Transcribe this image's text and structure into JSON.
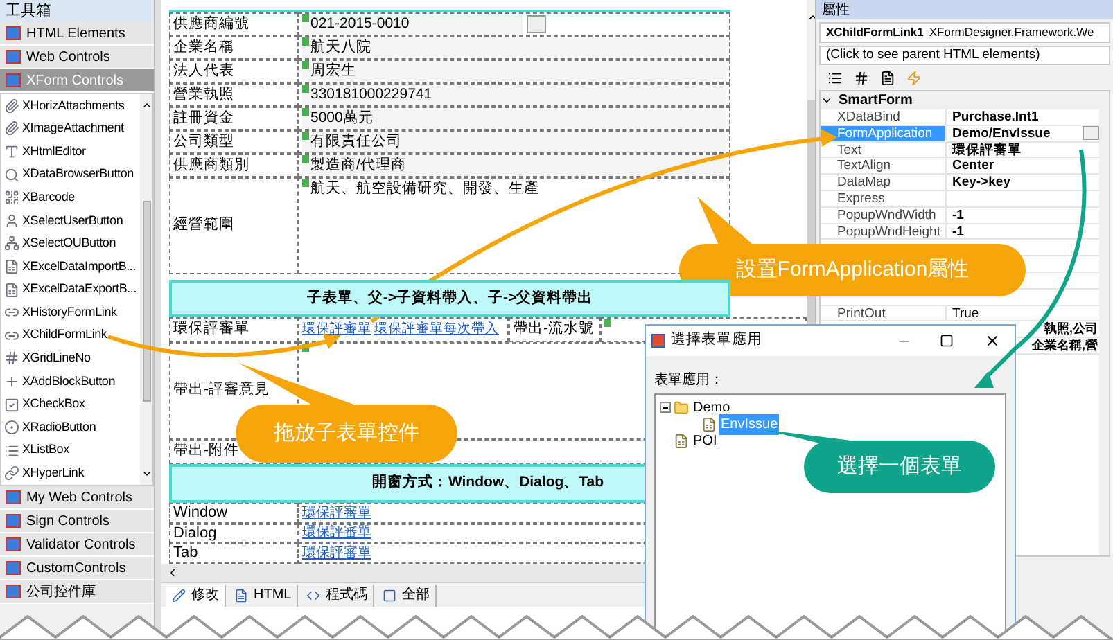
{
  "toolbox": {
    "title": "工具箱",
    "categories_top": [
      {
        "label": "HTML Elements",
        "selected": false
      },
      {
        "label": "Web Controls",
        "selected": false
      },
      {
        "label": "XForm Controls",
        "selected": true
      }
    ],
    "items": [
      "XHorizAttachments",
      "XImageAttachment",
      "XHtmlEditor",
      "XDataBrowserButton",
      "XBarcode",
      "XSelectUserButton",
      "XSelectOUButton",
      "XExcelDataImportB...",
      "XExcelDataExportB...",
      "XHistoryFormLink",
      "XChildFormLink",
      "XGridLineNo",
      "XAddBlockButton",
      "XCheckBox",
      "XRadioButton",
      "XListBox",
      "XHyperLink"
    ],
    "categories_bottom": [
      {
        "label": "My Web Controls",
        "selected": false
      },
      {
        "label": "Sign Controls",
        "selected": false
      },
      {
        "label": "Validator Controls",
        "selected": false
      },
      {
        "label": "CustomControls",
        "selected": false
      },
      {
        "label": "公司控件庫",
        "selected": false
      }
    ]
  },
  "designer": {
    "info_rows": [
      {
        "label": "供應商編號",
        "value": "021-2015-0010",
        "kind": "button"
      },
      {
        "label": "企業名稱",
        "value": "航天八院",
        "kind": "text"
      },
      {
        "label": "法人代表",
        "value": "周宏生",
        "kind": "text"
      },
      {
        "label": "營業執照",
        "value": "330181000229741",
        "kind": "text"
      },
      {
        "label": "註冊資金",
        "value": "5000萬元",
        "kind": "text"
      },
      {
        "label": "公司類型",
        "value": "有限責任公司",
        "kind": "text"
      },
      {
        "label": "供應商類別",
        "value": "製造商/代理商",
        "kind": "text"
      },
      {
        "label": "經營範圍",
        "value": "航天、航空設備研究、開發、生產",
        "kind": "area"
      }
    ],
    "section_1": "子表單、父->子資料帶入、子->父資料帶出",
    "link_row": {
      "label": "環保評審單",
      "links": [
        "環保評審單",
        "環保評審單每次帶入"
      ],
      "label_2": "帶出-流水號"
    },
    "review_label": "帶出-評審意見",
    "attach_label": "帶出-附件",
    "section_2": "開窗方式：Window、Dialog、Tab",
    "mode_rows": [
      {
        "label": "Window",
        "link": "環保評審單"
      },
      {
        "label": "Dialog",
        "link": "環保評審單"
      },
      {
        "label": "Tab",
        "link": "環保評審單"
      }
    ],
    "bottom_tabs": [
      {
        "label": "修改",
        "selected": true
      },
      {
        "label": "HTML",
        "selected": false
      },
      {
        "label": "程式碼",
        "selected": false
      },
      {
        "label": "全部",
        "selected": false
      }
    ]
  },
  "properties": {
    "title": "屬性",
    "object_name": "XChildFormLink1",
    "object_type": "XFormDesigner.Framework.We",
    "parent_hint": "(Click to see parent HTML elements)",
    "category": "SmartForm",
    "rows": [
      {
        "name": "XDataBind",
        "value": "Purchase.Int1",
        "selected": false
      },
      {
        "name": "FormApplication",
        "value": "Demo/EnvIssue",
        "selected": true
      },
      {
        "name": "Text",
        "value": "環保評審單",
        "selected": false
      },
      {
        "name": "TextAlign",
        "value": "Center",
        "selected": false
      },
      {
        "name": "DataMap",
        "value": "Key->key",
        "selected": false
      },
      {
        "name": "Express",
        "value": "",
        "selected": false
      },
      {
        "name": "PopupWndWidth",
        "value": "-1",
        "selected": false
      },
      {
        "name": "PopupWndHeight",
        "value": "-1",
        "selected": false
      }
    ],
    "printout": {
      "name": "PrintOut",
      "value": "True"
    },
    "partial_values": [
      "執照,公司",
      "企業名稱,營"
    ]
  },
  "dialog": {
    "title": "選擇表單應用",
    "label": "表單應用：",
    "tree": [
      {
        "label": "Demo",
        "kind": "folder",
        "expanded": true,
        "selected": false,
        "children": [
          {
            "label": "EnvIssue",
            "kind": "form",
            "selected": true
          }
        ]
      },
      {
        "label": "POI",
        "kind": "form",
        "selected": false
      }
    ]
  },
  "callouts": [
    {
      "text": "拖放子表單控件",
      "color": "#f5a50a"
    },
    {
      "text": "設置FormApplication屬性",
      "color": "#f5a50a"
    },
    {
      "text": "選擇一個表單",
      "color": "#10a58a"
    }
  ]
}
